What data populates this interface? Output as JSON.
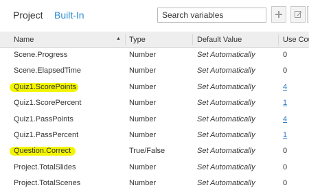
{
  "tabs": {
    "project": "Project",
    "builtin": "Built-In"
  },
  "search": {
    "placeholder": "Search variables"
  },
  "toolbar": {
    "add_icon": "plus-icon",
    "edit_icon": "edit-icon"
  },
  "columns": {
    "name": "Name",
    "type": "Type",
    "default": "Default Value",
    "use_count": "Use Cou"
  },
  "rows": [
    {
      "name": "Scene.Progress",
      "type": "Number",
      "default": "Set Automatically",
      "use": "0",
      "link": false,
      "highlight": false
    },
    {
      "name": "Scene.ElapsedTime",
      "type": "Number",
      "default": "Set Automatically",
      "use": "0",
      "link": false,
      "highlight": false
    },
    {
      "name": "Quiz1.ScorePoints",
      "type": "Number",
      "default": "Set Automatically",
      "use": "4",
      "link": true,
      "highlight": true
    },
    {
      "name": "Quiz1.ScorePercent",
      "type": "Number",
      "default": "Set Automatically",
      "use": "1",
      "link": true,
      "highlight": false
    },
    {
      "name": "Quiz1.PassPoints",
      "type": "Number",
      "default": "Set Automatically",
      "use": "4",
      "link": true,
      "highlight": false
    },
    {
      "name": "Quiz1.PassPercent",
      "type": "Number",
      "default": "Set Automatically",
      "use": "1",
      "link": true,
      "highlight": false
    },
    {
      "name": "Question.Correct",
      "type": "True/False",
      "default": "Set Automatically",
      "use": "0",
      "link": false,
      "highlight": true
    },
    {
      "name": "Project.TotalSlides",
      "type": "Number",
      "default": "Set Automatically",
      "use": "0",
      "link": false,
      "highlight": false
    },
    {
      "name": "Project.TotalScenes",
      "type": "Number",
      "default": "Set Automatically",
      "use": "0",
      "link": false,
      "highlight": false
    }
  ],
  "colors": {
    "accent": "#2a8bd0",
    "highlight": "#f3f500",
    "link": "#2a7ac8"
  }
}
